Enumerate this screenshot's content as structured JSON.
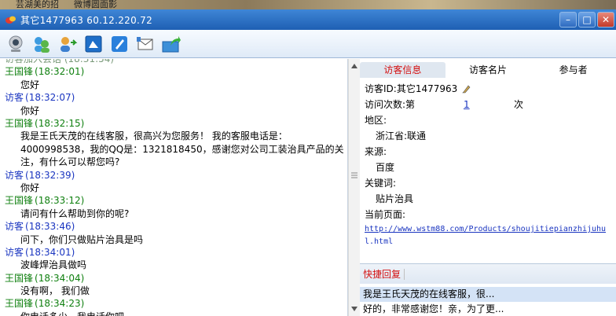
{
  "background": {
    "text1": "芸湖美的招",
    "text2": "微博圆面影"
  },
  "window": {
    "title": "其它1477963  60.12.220.72",
    "minimize": "–",
    "maximize": "□",
    "close": "✕"
  },
  "toolbar": {
    "icons": [
      "webcam-icon",
      "chat-users-icon",
      "transfer-user-icon",
      "screenshot-icon",
      "edit-icon",
      "message-icon",
      "export-icon"
    ]
  },
  "chat": {
    "cut_top": "访客加入会话 (18:31:54)",
    "messages": [
      {
        "sender": "王国锋",
        "time": "(18:32:01)",
        "role": "staff",
        "text": "您好"
      },
      {
        "sender": "访客",
        "time": "(18:32:07)",
        "role": "visitor",
        "text": "你好"
      },
      {
        "sender": "王国锋",
        "time": "(18:32:15)",
        "role": "staff",
        "text": " 我是王氏天茂的在线客服，很高兴为您服务！ 我的客服电话是：4000998538，我的QQ是：1321818450，感谢您对公司工装治具产品的关注，有什么可以帮您吗?"
      },
      {
        "sender": "访客",
        "time": "(18:32:39)",
        "role": "visitor",
        "text": "你好"
      },
      {
        "sender": "王国锋",
        "time": "(18:33:12)",
        "role": "staff",
        "text": "请问有什么帮助到你的呢?"
      },
      {
        "sender": "访客",
        "time": "(18:33:46)",
        "role": "visitor",
        "text": "问下，你们只做贴片治具是吗"
      },
      {
        "sender": "访客",
        "time": "(18:34:01)",
        "role": "visitor",
        "text": "波峰焊治具做吗"
      },
      {
        "sender": "王国锋",
        "time": "(18:34:04)",
        "role": "staff",
        "text": "没有啊， 我们做"
      },
      {
        "sender": "王国锋",
        "time": "(18:34:23)",
        "role": "staff",
        "text": "你电话多少，我电话你吧"
      }
    ]
  },
  "right_panel": {
    "tabs": [
      "访客信息",
      "访客名片",
      "参与者"
    ],
    "visitor_id_label": "访客ID:",
    "visitor_id": "其它1477963",
    "visit_count_label": "访问次数:第",
    "visit_count": "1",
    "visit_count_unit": "次",
    "region_label": "地区:",
    "region": "浙江省:联通",
    "source_label": "来源:",
    "source": "百度",
    "keyword_label": "关键词:",
    "keyword": "贴片治具",
    "current_page_label": "当前页面:",
    "current_page_url": "http://www.wstm88.com/Products/shoujitiepianzhijuhul.html",
    "quick_reply_label": "快捷回复",
    "quick_replies": [
      "我是王氏天茂的在线客服，很...",
      "好的，非常感谢您！亲，为了更..."
    ]
  }
}
